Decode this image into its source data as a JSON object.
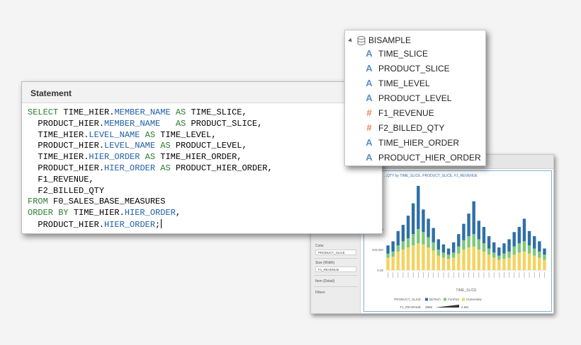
{
  "statement": {
    "title": "Statement",
    "sql_lines": [
      [
        {
          "t": "SELECT ",
          "c": "kw"
        },
        {
          "t": "TIME_HIER.",
          "c": ""
        },
        {
          "t": "MEMBER_NAME",
          "c": "fld"
        },
        {
          "t": " AS ",
          "c": "kw"
        },
        {
          "t": "TIME_SLICE,",
          "c": ""
        }
      ],
      [
        {
          "t": "  PRODUCT_HIER.",
          "c": ""
        },
        {
          "t": "MEMBER_NAME",
          "c": "fld"
        },
        {
          "t": "   AS ",
          "c": "kw"
        },
        {
          "t": "PRODUCT_SLICE,",
          "c": ""
        }
      ],
      [
        {
          "t": "  TIME_HIER.",
          "c": ""
        },
        {
          "t": "LEVEL_NAME",
          "c": "fld"
        },
        {
          "t": " AS ",
          "c": "kw"
        },
        {
          "t": "TIME_LEVEL,",
          "c": ""
        }
      ],
      [
        {
          "t": "  PRODUCT_HIER.",
          "c": ""
        },
        {
          "t": "LEVEL_NAME",
          "c": "fld"
        },
        {
          "t": " AS ",
          "c": "kw"
        },
        {
          "t": "PRODUCT_LEVEL,",
          "c": ""
        }
      ],
      [
        {
          "t": "  TIME_HIER.",
          "c": ""
        },
        {
          "t": "HIER_ORDER",
          "c": "fld"
        },
        {
          "t": " AS ",
          "c": "kw"
        },
        {
          "t": "TIME_HIER_ORDER,",
          "c": ""
        }
      ],
      [
        {
          "t": "  PRODUCT_HIER.",
          "c": ""
        },
        {
          "t": "HIER_ORDER",
          "c": "fld"
        },
        {
          "t": " AS ",
          "c": "kw"
        },
        {
          "t": "PRODUCT_HIER_ORDER,",
          "c": ""
        }
      ],
      [
        {
          "t": "  F1_REVENUE,",
          "c": ""
        }
      ],
      [
        {
          "t": "  F2_BILLED_QTY",
          "c": ""
        }
      ],
      [
        {
          "t": "FROM ",
          "c": "kw"
        },
        {
          "t": "F0_SALES_BASE_MEASURES",
          "c": ""
        }
      ],
      [
        {
          "t": "ORDER BY ",
          "c": "kw"
        },
        {
          "t": "TIME_HIER.",
          "c": ""
        },
        {
          "t": "HIER_ORDER",
          "c": "fld"
        },
        {
          "t": ",",
          "c": ""
        }
      ],
      [
        {
          "t": "  PRODUCT_HIER.",
          "c": ""
        },
        {
          "t": "HIER_ORDER",
          "c": "fld"
        },
        {
          "t": ";",
          "c": ""
        }
      ]
    ]
  },
  "tree": {
    "root_label": "BISAMPLE",
    "items": [
      {
        "label": "TIME_SLICE",
        "kind": "attribute",
        "glyph": "A"
      },
      {
        "label": "PRODUCT_SLICE",
        "kind": "attribute",
        "glyph": "A"
      },
      {
        "label": "TIME_LEVEL",
        "kind": "attribute",
        "glyph": "A"
      },
      {
        "label": "PRODUCT_LEVEL",
        "kind": "attribute",
        "glyph": "A"
      },
      {
        "label": "F1_REVENUE",
        "kind": "measure",
        "glyph": "#"
      },
      {
        "label": "F2_BILLED_QTY",
        "kind": "measure",
        "glyph": "#"
      },
      {
        "label": "TIME_HIER_ORDER",
        "kind": "attribute",
        "glyph": "A"
      },
      {
        "label": "PRODUCT_HIER_ORDER",
        "kind": "attribute",
        "glyph": "A"
      }
    ]
  },
  "chart_sidebar": {
    "color_label": "Color",
    "color_value": "PRODUCT_SLICE",
    "size_label": "Size (Width)",
    "size_value": "F1_REVENUE",
    "detail_label": "Item (Detail)",
    "filters_label": "Filters"
  },
  "chart_data": {
    "type": "bar",
    "title": "...QTY by TIME_SLICE, PRODUCT_SLICE, F1_REVENUE",
    "xlabel": "TIME_SLICE",
    "ylabel": "",
    "y_ticks": [
      "200,000",
      "100,000",
      "0.00"
    ],
    "ylim": [
      0,
      420000
    ],
    "legend_title": "PRODUCT_SLICE",
    "legend": [
      {
        "name": "BizTech",
        "color": "#2f6fa7"
      },
      {
        "name": "FunPod",
        "color": "#7ec87a"
      },
      {
        "name": "HomeView",
        "color": "#f4d35e"
      }
    ],
    "size_legend_label": "F1_REVENUE",
    "size_legend_min": "3868",
    "size_legend_max": "2.5M",
    "series": [
      {
        "name": "HomeView",
        "values": [
          60000,
          65000,
          90000,
          100000,
          110000,
          120000,
          130000,
          125000,
          110000,
          95000,
          70000,
          60000,
          55000,
          60000,
          80000,
          100000,
          110000,
          115000,
          100000,
          90000,
          75000,
          60000,
          50000,
          55000,
          60000,
          75000,
          85000,
          90000,
          80000,
          70000,
          60000,
          50000
        ]
      },
      {
        "name": "FunPod",
        "values": [
          20000,
          25000,
          30000,
          40000,
          45000,
          55000,
          70000,
          60000,
          50000,
          40000,
          30000,
          25000,
          20000,
          25000,
          35000,
          45000,
          55000,
          60000,
          50000,
          40000,
          30000,
          25000,
          20000,
          25000,
          30000,
          40000,
          45000,
          50000,
          40000,
          35000,
          30000,
          25000
        ]
      },
      {
        "name": "BizTech",
        "values": [
          40000,
          50000,
          70000,
          80000,
          110000,
          150000,
          210000,
          110000,
          90000,
          70000,
          50000,
          40000,
          30000,
          50000,
          60000,
          80000,
          110000,
          160000,
          90000,
          80000,
          60000,
          50000,
          40000,
          50000,
          60000,
          70000,
          80000,
          110000,
          70000,
          60000,
          50000,
          30000
        ]
      }
    ],
    "categories_count": 32
  }
}
